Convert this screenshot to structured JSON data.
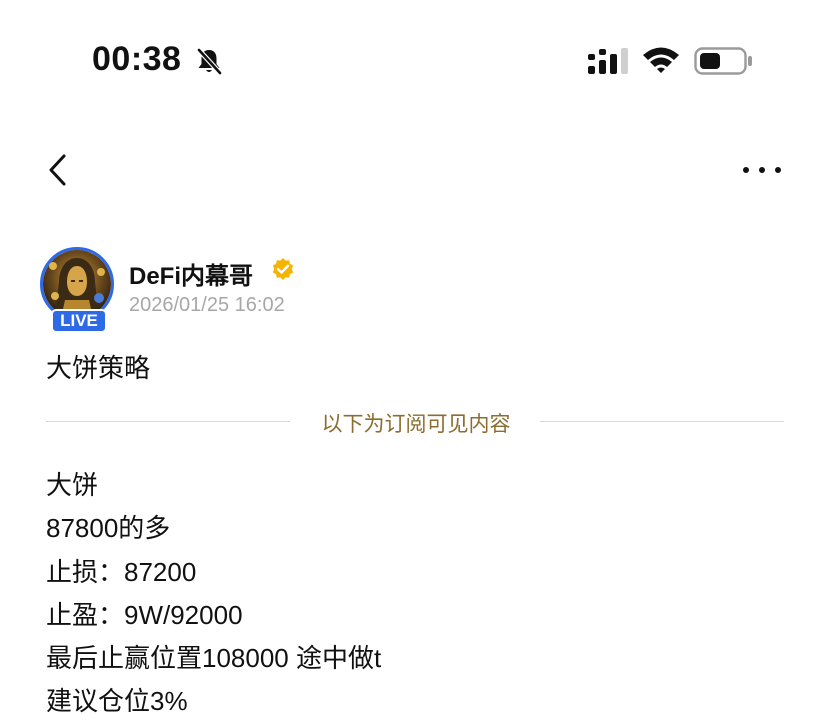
{
  "status_bar": {
    "time": "00:38"
  },
  "post": {
    "author": {
      "name": "DeFi内幕哥",
      "live_label": "LIVE",
      "timestamp": "2026/01/25 16:02"
    },
    "title": "大饼策略",
    "subscription_divider": "以下为订阅可见内容",
    "body_lines": [
      "大饼",
      "87800的多",
      "止损：87200",
      "止盈：9W/92000",
      "最后止赢位置108000 途中做t",
      "建议仓位3%"
    ]
  },
  "colors": {
    "accent_blue": "#2f6ae6",
    "divider_gold": "#8b6e2f",
    "verified_gold": "#f5b400",
    "muted_gray": "#a7a7a7"
  }
}
